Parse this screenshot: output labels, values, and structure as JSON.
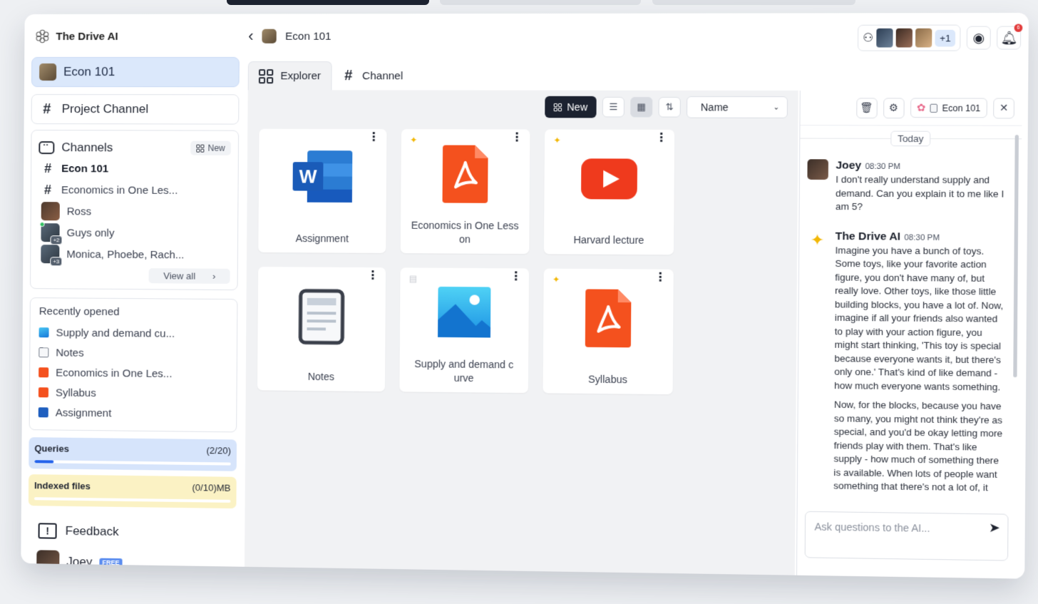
{
  "brand": {
    "name": "The Drive AI"
  },
  "sidebar": {
    "course": "Econ 101",
    "project": "Project Channel",
    "channels": {
      "title": "Channels",
      "new_label": "New",
      "items": [
        {
          "label": "Econ 101",
          "kind": "hash"
        },
        {
          "label": "Economics in One Les...",
          "kind": "hash"
        },
        {
          "label": "Ross",
          "kind": "dm"
        },
        {
          "label": "Guys only",
          "kind": "group",
          "badge": "+2"
        },
        {
          "label": "Monica, Phoebe, Rach...",
          "kind": "group",
          "badge": "+3"
        }
      ],
      "view_all": "View all"
    },
    "recent": {
      "title": "Recently opened",
      "items": [
        {
          "label": "Supply and demand cu...",
          "icon": "image-file-icon"
        },
        {
          "label": "Notes",
          "icon": "note-file-icon"
        },
        {
          "label": "Economics in One Les...",
          "icon": "pdf-file-icon"
        },
        {
          "label": "Syllabus",
          "icon": "pdf-file-icon"
        },
        {
          "label": "Assignment",
          "icon": "word-file-icon"
        }
      ]
    },
    "queries": {
      "label": "Queries",
      "value": "(2/20)",
      "fraction": 0.1
    },
    "indexed": {
      "label": "Indexed files",
      "value": "(0/10)MB",
      "fraction": 0.0
    },
    "feedback": "Feedback",
    "user": {
      "name": "Joey",
      "plan": "FREE"
    }
  },
  "header": {
    "title": "Econ 101",
    "members_extra": "+1",
    "notifications": "6"
  },
  "tabs": {
    "explorer": "Explorer",
    "channel": "Channel"
  },
  "toolbar": {
    "new_label": "New",
    "sort_value": "Name"
  },
  "files": [
    {
      "name": "Assignment",
      "type": "word"
    },
    {
      "name": "Economics in One Less on",
      "type": "pdf"
    },
    {
      "name": "Harvard lecture",
      "type": "youtube"
    },
    {
      "name": "Notes",
      "type": "note"
    },
    {
      "name": "Supply and demand c urve",
      "type": "image"
    },
    {
      "name": "Syllabus",
      "type": "pdf"
    }
  ],
  "chat": {
    "context": "Econ 101",
    "date_divider": "Today",
    "messages": [
      {
        "author": "Joey",
        "time": "08:30 PM",
        "text": "I don't really understand supply and demand. Can you explain it to me like I am 5?"
      },
      {
        "author": "The Drive AI",
        "time": "08:30 PM",
        "text": "Imagine you have a bunch of toys. Some toys, like your favorite action figure, you don't have many of, but really love. Other toys, like those little building blocks, you have a lot of. Now, imagine if all your friends also wanted to play with your action figure, you might start thinking, 'This toy is special because everyone wants it, but there's only one.' That's kind of like demand - how much everyone wants something.",
        "text2": "Now, for the blocks, because you have so many, you might not think they're as special, and you'd be okay letting more friends play with them. That's like supply - how much of something there is available. When lots of people want something that there's not a lot of, it"
      }
    ],
    "input_placeholder": "Ask questions to the AI..."
  }
}
